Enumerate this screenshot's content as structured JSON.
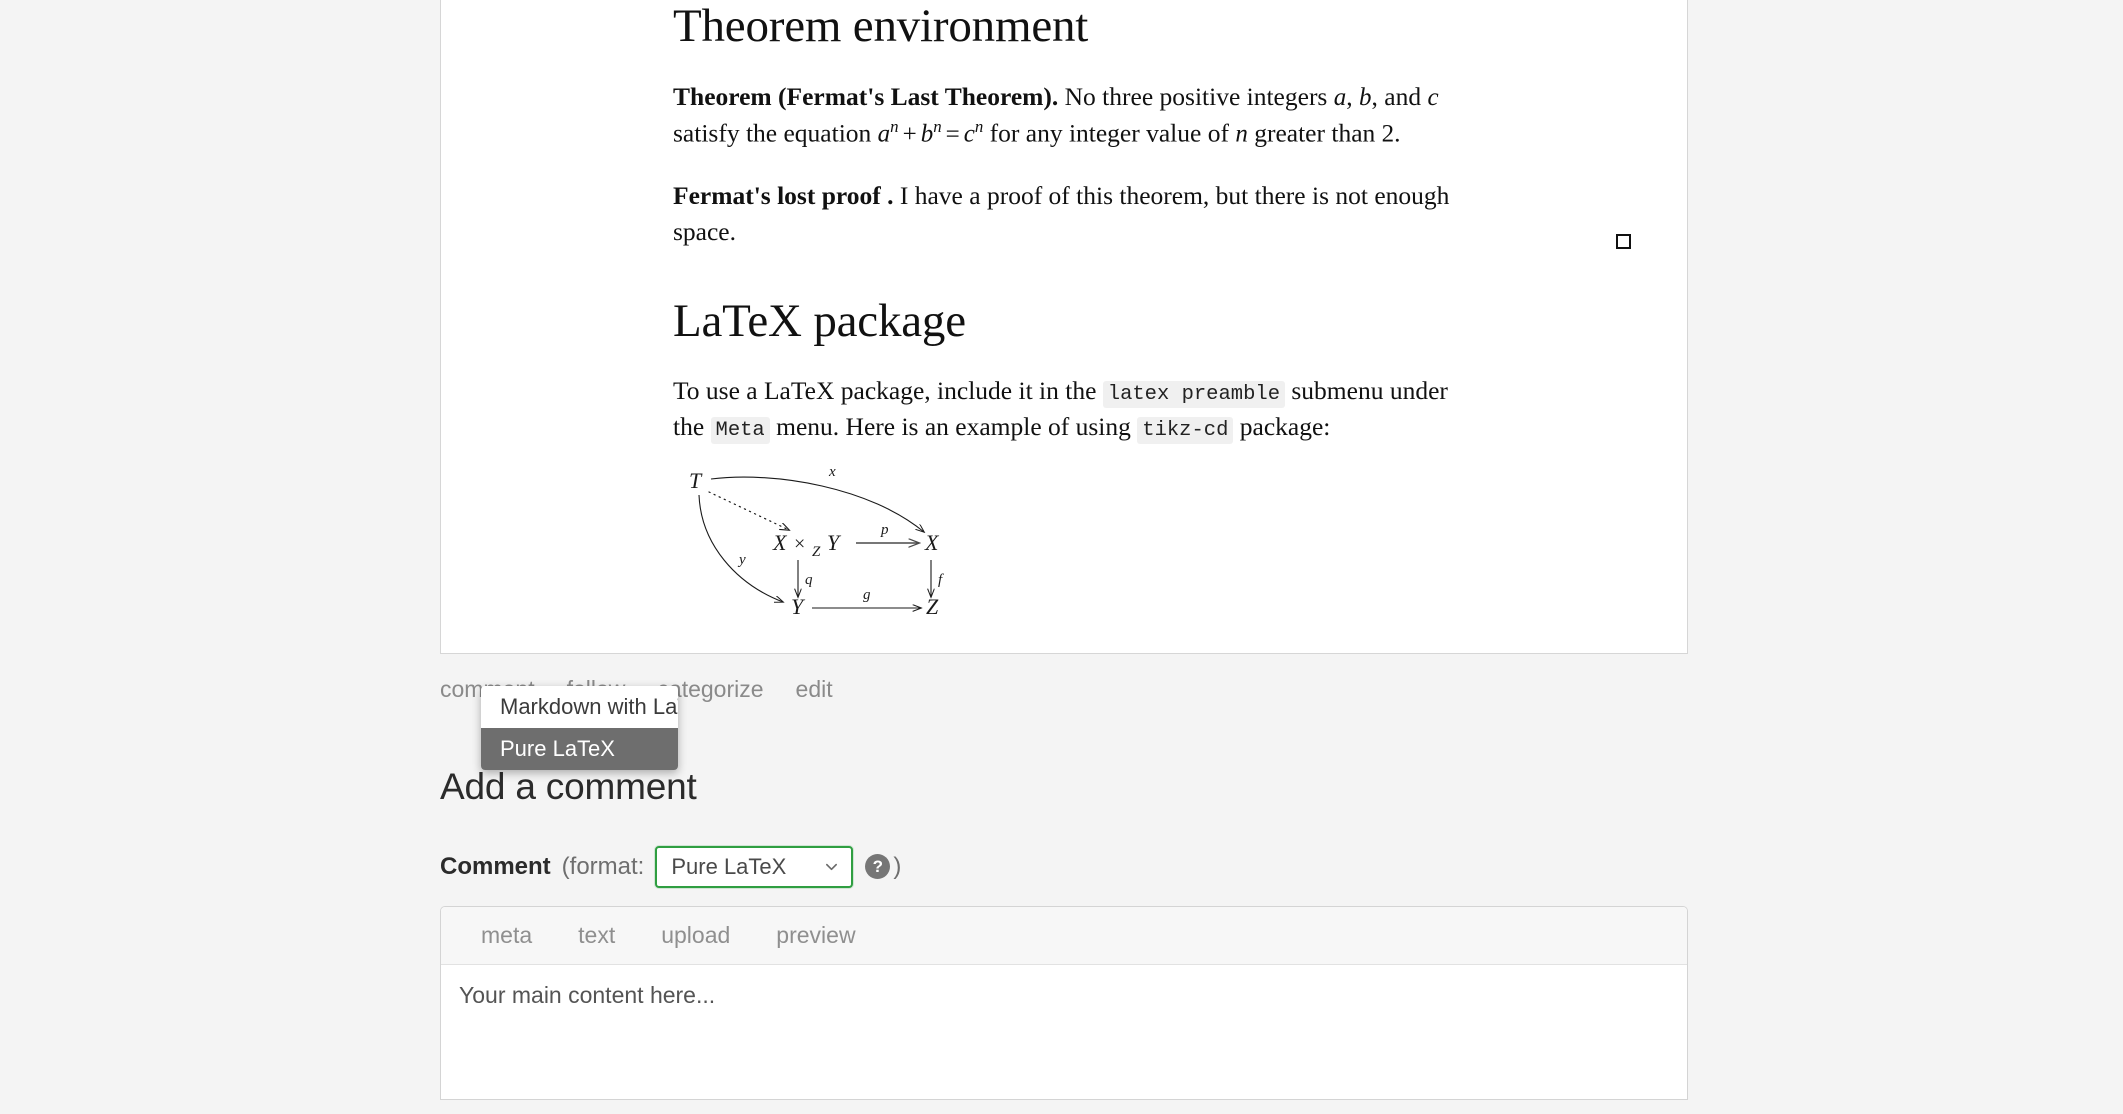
{
  "article": {
    "heading1": "Theorem environment",
    "theorem": {
      "label": "Theorem (Fermat's Last Theorem).",
      "text_1": " No three positive integers ",
      "var_a": "a",
      "comma1": ", ",
      "var_b": "b",
      "comma2": ",",
      "text_2": "and ",
      "var_c": "c",
      "text_3": " satisfy the equation ",
      "eq_a": "a",
      "eq_an": "n",
      "eq_plus": "+",
      "eq_b": "b",
      "eq_bn": "n",
      "eq_eq": "=",
      "eq_c": "c",
      "eq_cn": "n",
      "text_4": " for any integer value of ",
      "var_n": "n",
      "text_5": " greater",
      "text_6": "than ",
      "num_2": "2",
      "period": "."
    },
    "proof": {
      "label": "Fermat's lost proof .",
      "text": " I have a proof of this theorem, but there is not enough space.",
      "qed": "qed-tombstone"
    },
    "heading2": "LaTeX package",
    "package_para": {
      "part1": "To use a LaTeX package, include it in the ",
      "code1": "latex preamble",
      "part2": " submenu under the ",
      "code2": "Meta",
      "part3": " menu. Here is an example of using ",
      "code3": "tikz-cd",
      "part4": " package:"
    },
    "diagram": {
      "type": "tikz-cd commutative pullback diagram",
      "nodes": [
        "T",
        "X ×Z Y",
        "X",
        "Y",
        "Z"
      ],
      "node_T": "T",
      "node_XZY_X": "X",
      "node_XZY_times": "×",
      "node_XZY_Z": "Z",
      "node_XZY_Y": "Y",
      "node_X": "X",
      "node_Y": "Y",
      "node_Z": "Z",
      "arrow_x": "x",
      "arrow_y": "y",
      "arrow_p": "p",
      "arrow_q": "q",
      "arrow_f": "f",
      "arrow_g": "g"
    }
  },
  "post_actions": [
    {
      "label": "comment",
      "name": "comment-link"
    },
    {
      "label": "follow",
      "name": "follow-link"
    },
    {
      "label": "categorize",
      "name": "categorize-link"
    },
    {
      "label": "edit",
      "name": "edit-link"
    }
  ],
  "comment_form": {
    "heading": "Add a comment",
    "field_label": "Comment",
    "format_prefix": "(format:",
    "format_suffix": ")",
    "help_icon": "question-mark-icon",
    "select": {
      "value": "Pure LaTeX",
      "chevron": "chevron-down-icon",
      "options": [
        "Markdown with LaTeX",
        "Pure LaTeX"
      ],
      "selected_index": 1,
      "focus_border_color": "#2f9e41",
      "highlight_color": "#6e6e6e"
    },
    "tabs": [
      "meta",
      "text",
      "upload",
      "preview"
    ],
    "textarea_placeholder": "Your main content here..."
  }
}
